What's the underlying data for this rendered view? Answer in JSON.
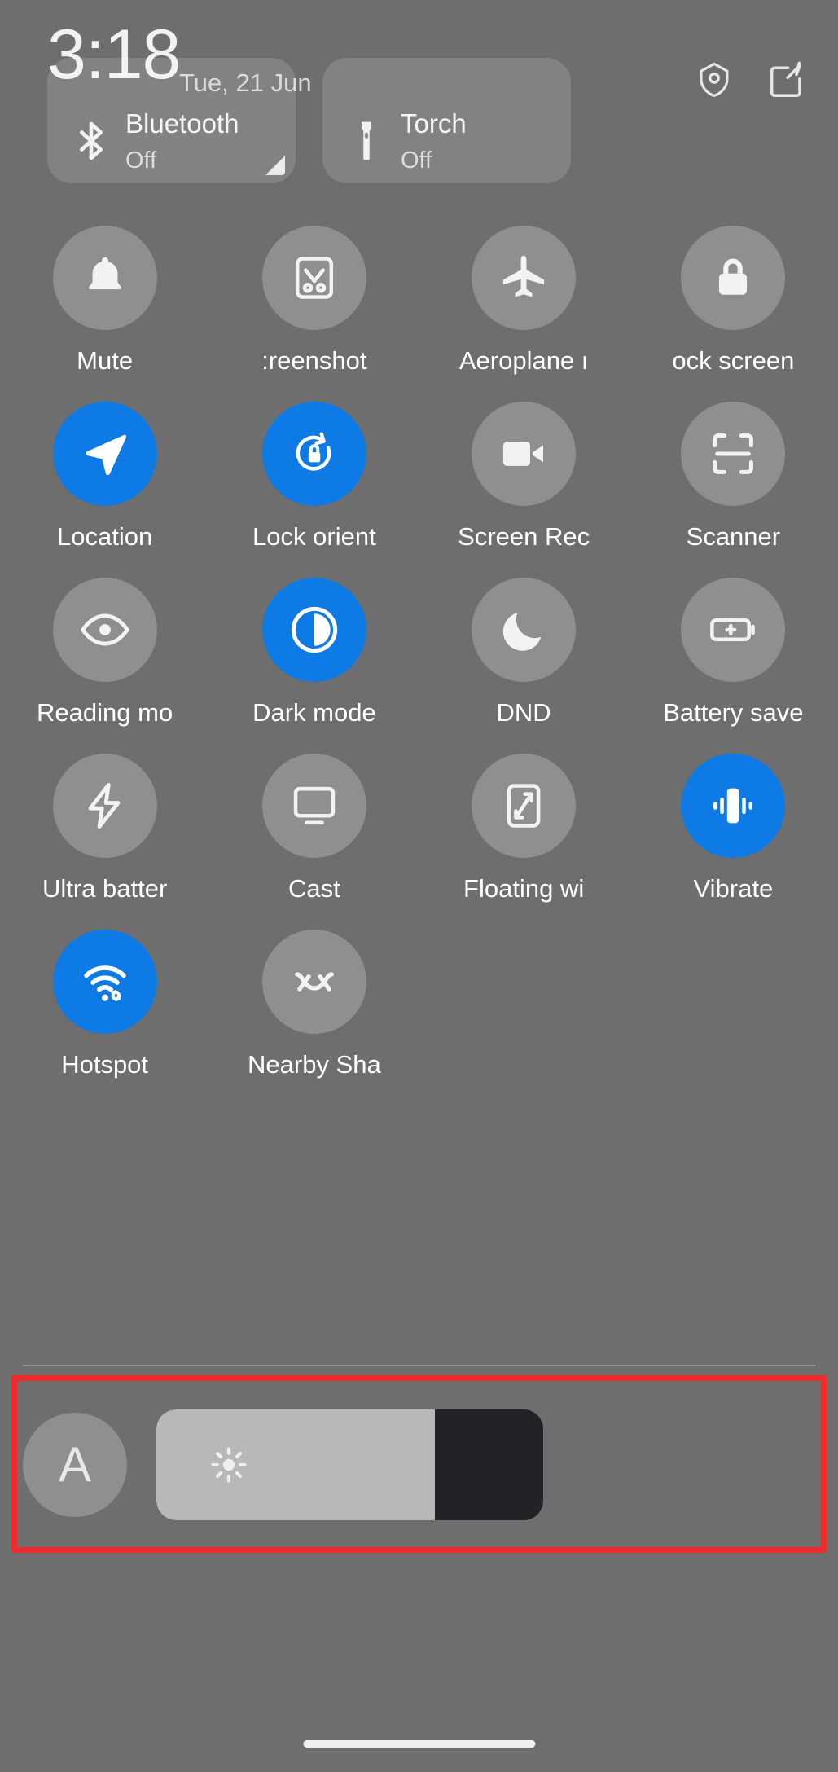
{
  "status": {
    "time": "3:18",
    "date": "Tue, 21 Jun",
    "icons": [
      {
        "name": "shield-settings-icon"
      },
      {
        "name": "edit-icon"
      }
    ]
  },
  "top_tiles": [
    {
      "title": "Bluetooth",
      "subtitle": "Off",
      "icon": "bluetooth-icon",
      "active": false
    },
    {
      "title": "Torch",
      "subtitle": "Off",
      "icon": "torch-icon",
      "active": false
    }
  ],
  "quick_settings": {
    "rows": [
      [
        {
          "label": "Mute",
          "icon": "bell-icon",
          "active": false
        },
        {
          "label": ":reenshot",
          "icon": "screenshot-icon",
          "active": false
        },
        {
          "label": "Aeroplane ı",
          "icon": "aeroplane-icon",
          "active": false
        },
        {
          "label": "ock screen",
          "icon": "lock-icon",
          "active": false
        }
      ],
      [
        {
          "label": "Location",
          "icon": "navigation-icon",
          "active": true
        },
        {
          "label": "Lock orient",
          "icon": "rotation-lock-icon",
          "active": true
        },
        {
          "label": "Screen Rec",
          "icon": "video-camera-icon",
          "active": false
        },
        {
          "label": "Scanner",
          "icon": "scanner-icon",
          "active": false
        }
      ],
      [
        {
          "label": "Reading mo",
          "icon": "eye-icon",
          "active": false
        },
        {
          "label": "Dark mode",
          "icon": "contrast-icon",
          "active": true
        },
        {
          "label": "DND",
          "icon": "moon-icon",
          "active": false
        },
        {
          "label": "Battery save",
          "icon": "battery-plus-icon",
          "active": false
        }
      ],
      [
        {
          "label": "Ultra batter",
          "icon": "lightning-icon",
          "active": false
        },
        {
          "label": "Cast",
          "icon": "monitor-icon",
          "active": false
        },
        {
          "label": "Floating wi",
          "icon": "floating-window-icon",
          "active": false
        },
        {
          "label": "Vibrate",
          "icon": "vibrate-icon",
          "active": true
        }
      ],
      [
        {
          "label": "Hotspot",
          "icon": "hotspot-icon",
          "active": true
        },
        {
          "label": "Nearby Sha",
          "icon": "nearby-share-icon",
          "active": false
        }
      ]
    ]
  },
  "brightness": {
    "auto_label": "A",
    "auto_icon": "auto-brightness-icon",
    "slider_icon": "sun-icon",
    "level_percent": 72,
    "highlight_color": "#f02b2b"
  },
  "colors": {
    "background": "#6e6e6e",
    "tile_inactive": "#8f8f8f",
    "tile_active": "#0d7ae5",
    "slider_track": "#222326",
    "slider_fill": "#b8b8b8",
    "highlight": "#f02b2b"
  },
  "navigation": {
    "home_indicator": "home-indicator"
  }
}
